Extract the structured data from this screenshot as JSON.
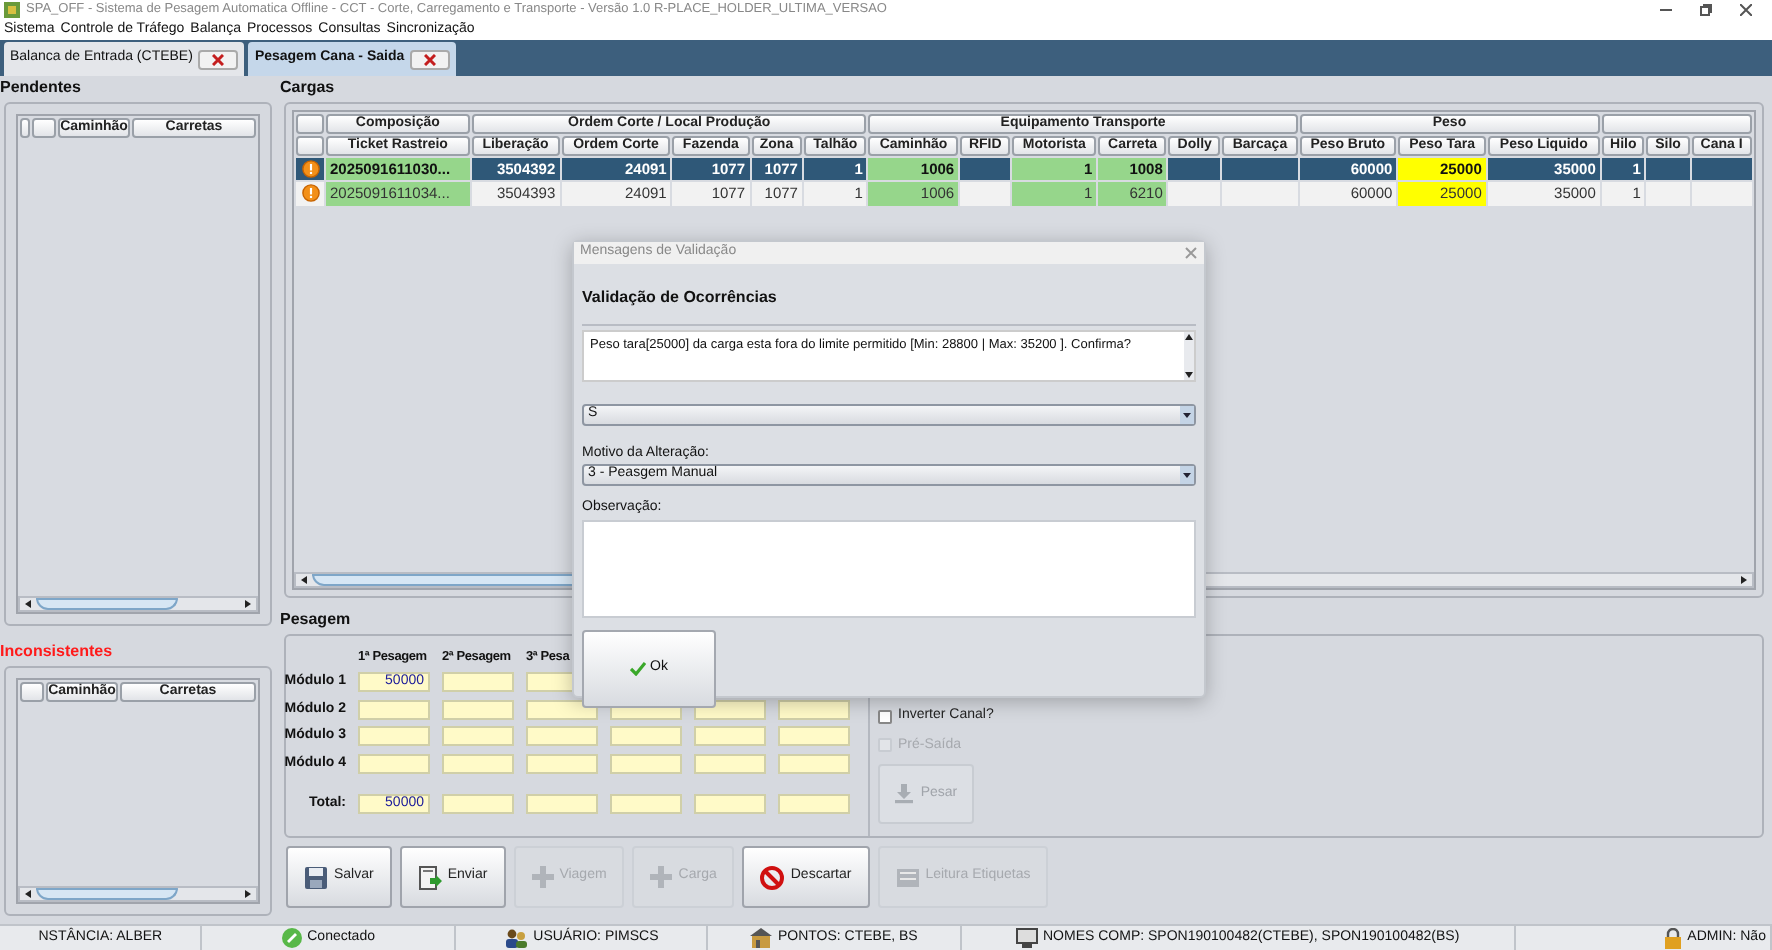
{
  "window": {
    "title": "SPA_OFF - Sistema de Pesagem Automatica Offline - CCT - Corte, Carregamento e Transporte - Versão 1.0 R-PLACE_HOLDER_ULTIMA_VERSAO"
  },
  "menu": [
    "Sistema",
    "Controle de Tráfego",
    "Balança",
    "Processos",
    "Consultas",
    "Sincronização"
  ],
  "tabs": [
    {
      "label": "Balanca de Entrada (CTEBE)",
      "selected": false
    },
    {
      "label": "Pesagem Cana - Saida",
      "selected": true
    }
  ],
  "pendentes": {
    "title": "Pendentes",
    "columns": [
      "Caminhão",
      "Carretas"
    ]
  },
  "inconsistentes": {
    "title": "Inconsistentes",
    "columns": [
      "Caminhão",
      "Carretas"
    ]
  },
  "cargas": {
    "title": "Cargas",
    "groups": [
      {
        "label": "Composição",
        "columns": [
          {
            "label": "Ticket Rastreio",
            "kind": "valid"
          }
        ]
      },
      {
        "label": "Ordem Corte / Local Produção",
        "columns": [
          {
            "label": "Liberação",
            "kind": "plain"
          },
          {
            "label": "Ordem Corte",
            "kind": "plain"
          },
          {
            "label": "Fazenda",
            "kind": "plain"
          },
          {
            "label": "Zona",
            "kind": "plain"
          },
          {
            "label": "Talhão",
            "kind": "plain"
          }
        ]
      },
      {
        "label": "Equipamento Transporte",
        "columns": [
          {
            "label": "Caminhão",
            "kind": "valid"
          },
          {
            "label": "RFID",
            "kind": "plain"
          },
          {
            "label": "Motorista",
            "kind": "valid"
          },
          {
            "label": "Carreta",
            "kind": "valid"
          },
          {
            "label": "Dolly",
            "kind": "plain"
          },
          {
            "label": "Barcaça",
            "kind": "plain"
          }
        ]
      },
      {
        "label": "Peso",
        "columns": [
          {
            "label": "Peso Bruto",
            "kind": "plain"
          },
          {
            "label": "Peso Tara",
            "kind": "alert"
          },
          {
            "label": "Peso Liquido",
            "kind": "plain"
          }
        ]
      },
      {
        "columns": [
          {
            "label": "Hilo",
            "kind": "plain"
          },
          {
            "label": "Silo",
            "kind": "plain"
          },
          {
            "label": "Cana I",
            "kind": "plain"
          }
        ]
      }
    ],
    "rows": [
      {
        "selected": true,
        "cells": [
          "2025091611030...",
          "3504392",
          "24091",
          "1077",
          "1077",
          "1",
          "1006",
          null,
          "1",
          "1008",
          null,
          null,
          "60000",
          "25000",
          "35000",
          "1",
          null,
          null
        ]
      },
      {
        "selected": false,
        "cells": [
          "2025091611034...",
          "3504393",
          "24091",
          "1077",
          "1077",
          "1",
          "1006",
          null,
          "1",
          "6210",
          null,
          null,
          "60000",
          "25000",
          "35000",
          "1",
          null,
          null
        ]
      }
    ]
  },
  "pesagem": {
    "title": "Pesagem",
    "columns": [
      "1ª Pesagem",
      "2ª Pesagem",
      "3ª Pesa"
    ],
    "rows": [
      {
        "label": "Módulo 1",
        "kind": "module",
        "values": [
          "50000"
        ]
      },
      {
        "label": "Módulo 2",
        "kind": "module",
        "values": []
      },
      {
        "label": "Módulo 3",
        "kind": "module",
        "values": []
      },
      {
        "label": "Módulo 4",
        "kind": "module",
        "values": []
      },
      {
        "label": "Total:",
        "kind": "total",
        "values": [
          "50000"
        ]
      }
    ],
    "options": [
      {
        "label": "Inverter Canal?",
        "checked": false,
        "disabled": false
      },
      {
        "label": "Pré-Saída",
        "checked": false,
        "disabled": true
      }
    ],
    "weigh_button": {
      "label": "Pesar",
      "disabled": true
    }
  },
  "actions": [
    {
      "label": "Salvar",
      "kind": "save",
      "disabled": false
    },
    {
      "label": "Enviar",
      "kind": "send",
      "disabled": false
    },
    {
      "label": "Viagem",
      "kind": "add",
      "disabled": true
    },
    {
      "label": "Carga",
      "kind": "add",
      "disabled": true
    },
    {
      "label": "Descartar",
      "kind": "discard",
      "disabled": false
    },
    {
      "label": "Leitura Etiquetas",
      "kind": "labels",
      "disabled": true
    }
  ],
  "status_bar": [
    {
      "text": "NSTÂNCIA: ALBER",
      "kind": "plain"
    },
    {
      "text": "Conectado",
      "kind": "link"
    },
    {
      "text": "USUÁRIO: PIMSCS",
      "kind": "user"
    },
    {
      "text": "PONTOS: CTEBE, BS",
      "kind": "point"
    },
    {
      "text": "NOMES COMP: SPON190100482(CTEBE), SPON190100482(BS)",
      "kind": "computer"
    },
    {
      "text": "ADMIN: Não",
      "kind": "lock"
    }
  ],
  "dialog": {
    "title": "Mensagens de Validação",
    "heading": "Validação de Ocorrências",
    "message": "Peso tara[25000] da carga esta fora do limite permitido [Min: 28800 | Max: 35200 ]. Confirma?",
    "answer": "S",
    "reason_label": "Motivo da Alteração:",
    "reason": "3 - Peasgem Manual",
    "note_label": "Observação:",
    "ok": "Ok"
  }
}
